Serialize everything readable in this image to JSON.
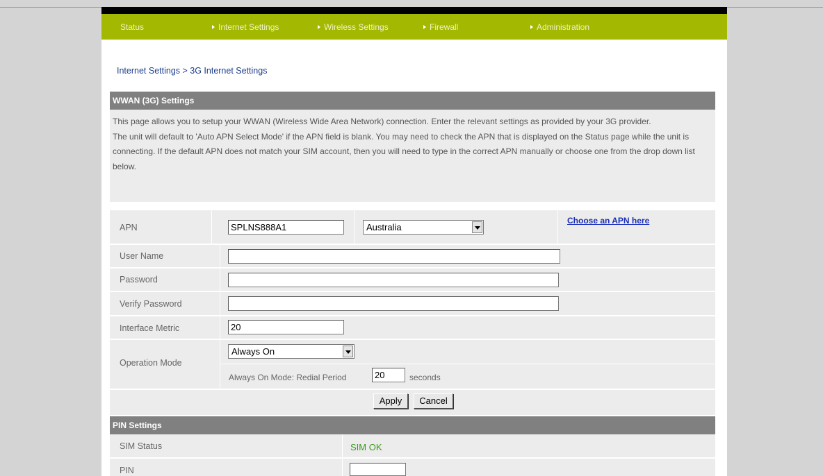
{
  "nav": {
    "items": [
      {
        "label": "Status",
        "arrow": false
      },
      {
        "label": "Internet Settings",
        "arrow": true
      },
      {
        "label": "Wireless Settings",
        "arrow": true
      },
      {
        "label": "Firewall",
        "arrow": true
      },
      {
        "label": "Administration",
        "arrow": true
      }
    ]
  },
  "breadcrumb": "Internet Settings > 3G Internet Settings",
  "wwan": {
    "title": "WWAN (3G) Settings",
    "desc1": "This page allows you to setup your WWAN (Wireless Wide Area Network) connection. Enter the relevant settings as provided by your 3G provider.",
    "desc2": "The unit will default to 'Auto APN Select Mode' if the APN field is blank. You may need to check the APN that is displayed on the Status page while the unit is connecting. If the default APN does not match your SIM account, then you will need to type in the correct APN manually or choose one from the drop down list below.",
    "apn_label": "APN",
    "apn_value": "SPLNS888A1",
    "country_selected": "Australia",
    "choose_apn_link": "Choose an APN here",
    "username_label": "User Name",
    "username_value": "",
    "password_label": "Password",
    "password_value": "",
    "verify_label": "Verify Password",
    "verify_value": "",
    "metric_label": "Interface Metric",
    "metric_value": "20",
    "opmode_label": "Operation Mode",
    "opmode_selected": "Always On",
    "redial_label": "Always On Mode: Redial Period",
    "redial_value": "20",
    "redial_unit": "seconds",
    "apply": "Apply",
    "cancel": "Cancel"
  },
  "pin": {
    "title": "PIN Settings",
    "sim_status_label": "SIM Status",
    "sim_status_value": "SIM OK",
    "pin_label": "PIN",
    "pin_value": ""
  },
  "colors": {
    "nav_bg": "#a3b800",
    "section_header": "#808080",
    "row_bg": "#ececec",
    "link": "#1a2fb8",
    "sim_ok": "#3a9a1a"
  }
}
